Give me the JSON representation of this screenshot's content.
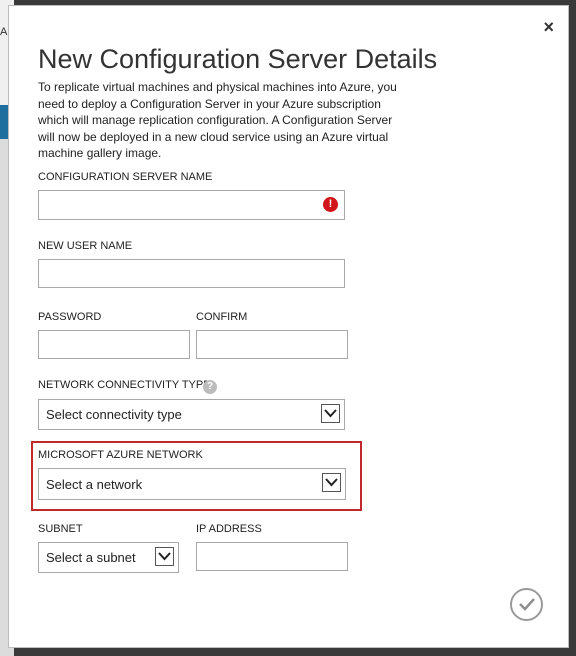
{
  "background": {
    "partial_text": "A"
  },
  "dialog": {
    "close_label": "×",
    "title": "New Configuration Server Details",
    "description": "To replicate virtual machines and physical machines into Azure, you need to deploy a Configuration Server in your Azure subscription which will manage replication configuration. A Configuration Server will now be deployed in a new cloud service using an Azure virtual machine gallery image.",
    "fields": {
      "server_name": {
        "label": "CONFIGURATION SERVER NAME",
        "value": "",
        "error_icon": "!"
      },
      "user_name": {
        "label": "NEW USER NAME",
        "value": ""
      },
      "password": {
        "label": "PASSWORD",
        "value": ""
      },
      "confirm": {
        "label": "CONFIRM",
        "value": ""
      },
      "connectivity": {
        "label": "NETWORK CONNECTIVITY TYPE",
        "help_icon": "?",
        "selected": "Select connectivity type"
      },
      "azure_network": {
        "label": "MICROSOFT AZURE NETWORK",
        "selected": "Select a network"
      },
      "subnet": {
        "label": "SUBNET",
        "selected": "Select a subnet"
      },
      "ip_address": {
        "label": "IP ADDRESS",
        "value": ""
      }
    },
    "colors": {
      "error": "#d1171c",
      "highlight": "#c0292b"
    }
  }
}
